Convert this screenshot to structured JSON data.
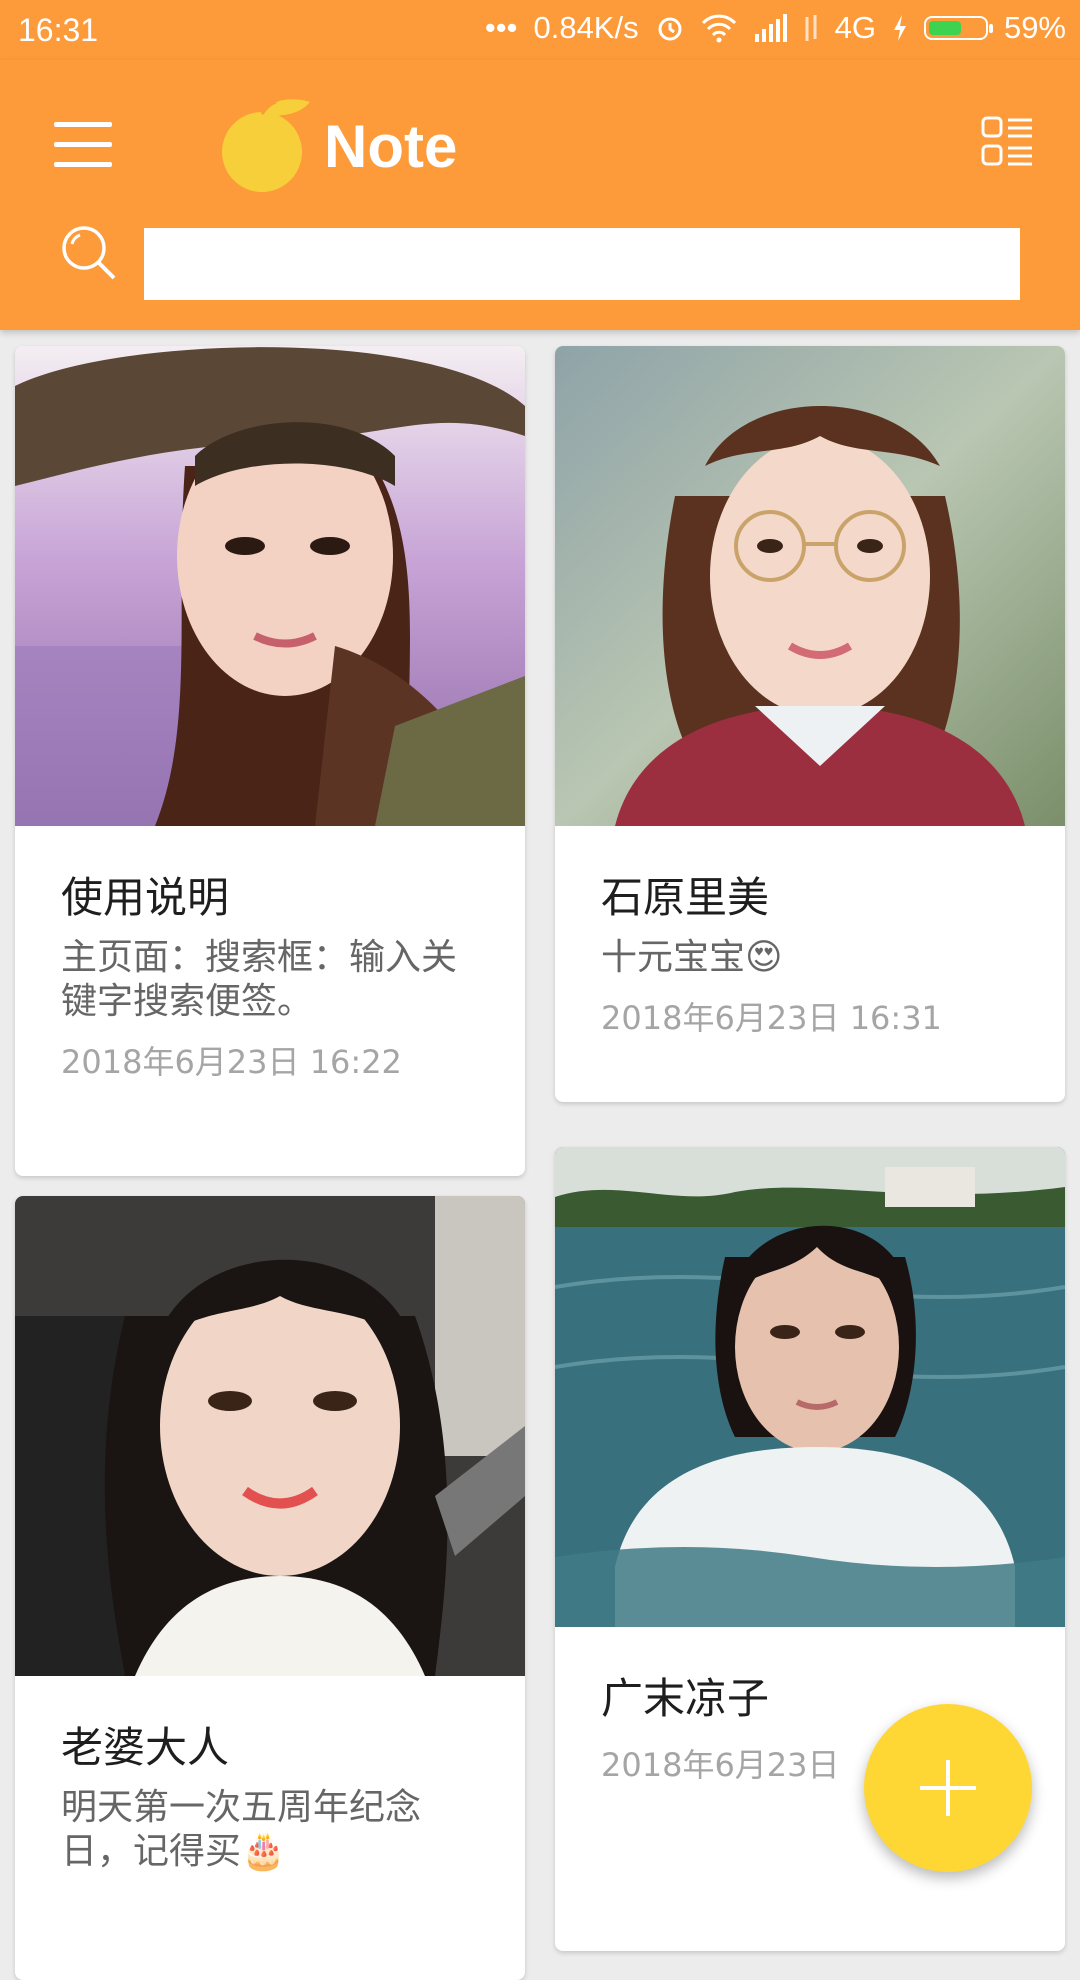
{
  "status_bar": {
    "time": "16:31",
    "dots": "•••",
    "speed": "0.84K/s",
    "network": "4G",
    "battery_percent": "59%",
    "battery_level": 0.59
  },
  "app_bar": {
    "title": "Note",
    "search": {
      "value": "",
      "placeholder": ""
    }
  },
  "notes": [
    {
      "title": "使用说明",
      "text": "主页面：搜索框：输入关键字搜索便签。",
      "date": "2018年6月23日  16:22"
    },
    {
      "title": "石原里美",
      "text": "十元宝宝😍",
      "date": "2018年6月23日  16:31"
    },
    {
      "title": "老婆大人",
      "text": "明天第一次五周年纪念日，记得买🎂",
      "date": ""
    },
    {
      "title": "广末凉子",
      "text": "",
      "date": "2018年6月23日"
    }
  ],
  "colors": {
    "primary": "#fd9a3a",
    "fab": "#ffd735",
    "logo": "#f7cf3a"
  },
  "icons": [
    "menu-icon",
    "orange-logo-icon",
    "layout-toggle-icon",
    "search-icon",
    "add-icon"
  ]
}
